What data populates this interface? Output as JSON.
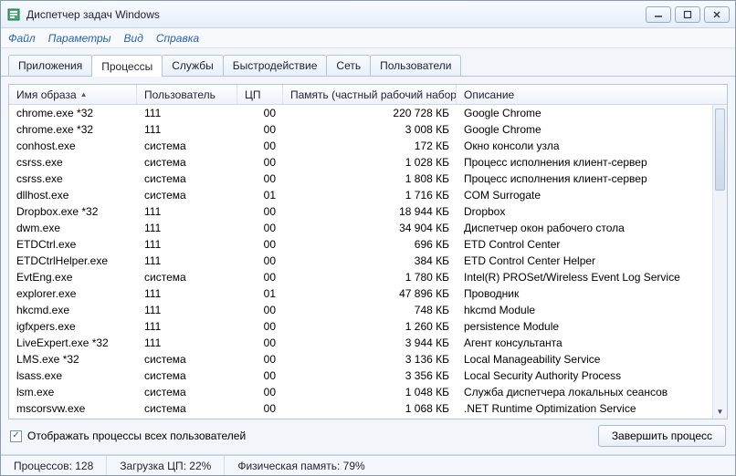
{
  "window": {
    "title": "Диспетчер задач Windows"
  },
  "menu": {
    "file": "Файл",
    "options": "Параметры",
    "view": "Вид",
    "help": "Справка"
  },
  "tabs": {
    "applications": "Приложения",
    "processes": "Процессы",
    "services": "Службы",
    "performance": "Быстродействие",
    "network": "Сеть",
    "users": "Пользователи"
  },
  "columns": {
    "image": "Имя образа",
    "user": "Пользователь",
    "cpu": "ЦП",
    "memory": "Память (частный рабочий набор)",
    "description": "Описание"
  },
  "rows": [
    {
      "image": "chrome.exe *32",
      "user": "111",
      "cpu": "00",
      "mem": "220 728 КБ",
      "desc": "Google Chrome"
    },
    {
      "image": "chrome.exe *32",
      "user": "111",
      "cpu": "00",
      "mem": "3 008 КБ",
      "desc": "Google Chrome"
    },
    {
      "image": "conhost.exe",
      "user": "система",
      "cpu": "00",
      "mem": "172 КБ",
      "desc": "Окно консоли узла"
    },
    {
      "image": "csrss.exe",
      "user": "система",
      "cpu": "00",
      "mem": "1 028 КБ",
      "desc": "Процесс исполнения клиент-сервер"
    },
    {
      "image": "csrss.exe",
      "user": "система",
      "cpu": "00",
      "mem": "1 808 КБ",
      "desc": "Процесс исполнения клиент-сервер"
    },
    {
      "image": "dllhost.exe",
      "user": "система",
      "cpu": "01",
      "mem": "1 716 КБ",
      "desc": "COM Surrogate"
    },
    {
      "image": "Dropbox.exe *32",
      "user": "111",
      "cpu": "00",
      "mem": "18 944 КБ",
      "desc": "Dropbox"
    },
    {
      "image": "dwm.exe",
      "user": "111",
      "cpu": "00",
      "mem": "34 904 КБ",
      "desc": "Диспетчер окон рабочего стола"
    },
    {
      "image": "ETDCtrl.exe",
      "user": "111",
      "cpu": "00",
      "mem": "696 КБ",
      "desc": "ETD Control Center"
    },
    {
      "image": "ETDCtrlHelper.exe",
      "user": "111",
      "cpu": "00",
      "mem": "384 КБ",
      "desc": "ETD Control Center Helper"
    },
    {
      "image": "EvtEng.exe",
      "user": "система",
      "cpu": "00",
      "mem": "1 780 КБ",
      "desc": "Intel(R) PROSet/Wireless Event Log Service"
    },
    {
      "image": "explorer.exe",
      "user": "111",
      "cpu": "01",
      "mem": "47 896 КБ",
      "desc": "Проводник"
    },
    {
      "image": "hkcmd.exe",
      "user": "111",
      "cpu": "00",
      "mem": "748 КБ",
      "desc": "hkcmd Module"
    },
    {
      "image": "igfxpers.exe",
      "user": "111",
      "cpu": "00",
      "mem": "1 260 КБ",
      "desc": "persistence Module"
    },
    {
      "image": "LiveExpert.exe *32",
      "user": "111",
      "cpu": "00",
      "mem": "3 944 КБ",
      "desc": "Агент консультанта"
    },
    {
      "image": "LMS.exe *32",
      "user": "система",
      "cpu": "00",
      "mem": "3 136 КБ",
      "desc": "Local Manageability Service"
    },
    {
      "image": "lsass.exe",
      "user": "система",
      "cpu": "00",
      "mem": "3 356 КБ",
      "desc": "Local Security Authority Process"
    },
    {
      "image": "lsm.exe",
      "user": "система",
      "cpu": "00",
      "mem": "1 048 КБ",
      "desc": "Служба диспетчера локальных сеансов"
    },
    {
      "image": "mscorsvw.exe",
      "user": "система",
      "cpu": "00",
      "mem": "1 068 КБ",
      "desc": ".NET Runtime Optimization Service"
    }
  ],
  "checkbox": {
    "label": "Отображать процессы всех пользователей",
    "checked": "✓"
  },
  "buttons": {
    "end_process": "Завершить процесс"
  },
  "status": {
    "processes": "Процессов: 128",
    "cpu": "Загрузка ЦП: 22%",
    "memory": "Физическая память: 79%"
  }
}
